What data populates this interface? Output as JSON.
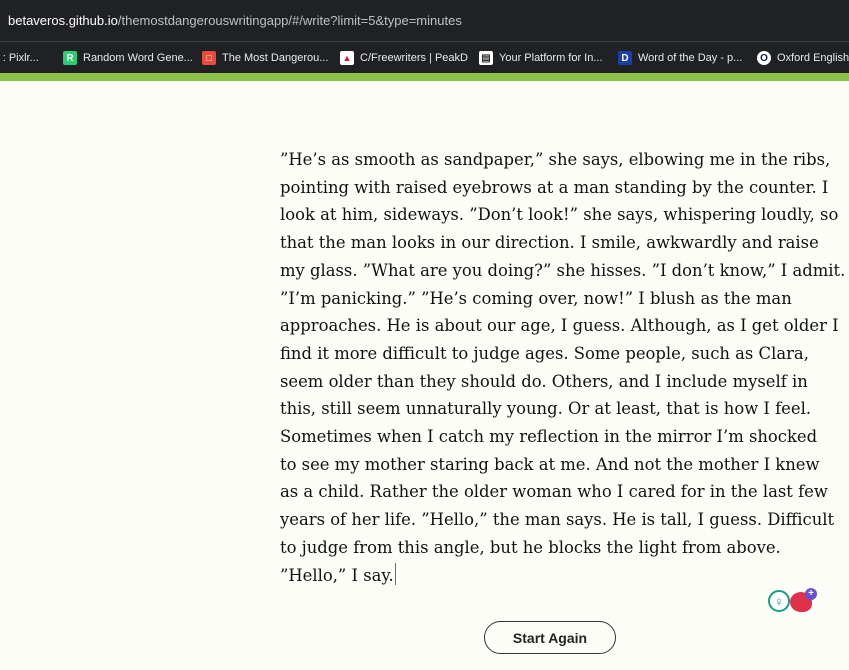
{
  "browser": {
    "url_host": "betaveros.github.io",
    "url_path": "/themostdangerouswritingapp/#/write?limit=5&type=minutes"
  },
  "bookmarks": [
    {
      "label": "r : Pixlr...",
      "icon": "pixlr-icon",
      "color": ""
    },
    {
      "label": "Random Word Gene...",
      "icon": "random-word-icon",
      "color": "#2ecc71",
      "glyph": "R"
    },
    {
      "label": "The Most Dangerou...",
      "icon": "dangerous-app-icon",
      "color": "#e74c3c",
      "glyph": "□"
    },
    {
      "label": "C/Freewriters | PeakD",
      "icon": "peakd-icon",
      "color": "#ffffff",
      "glyph": "▲"
    },
    {
      "label": "Your Platform for In...",
      "icon": "platform-icon",
      "color": "#ffffff",
      "glyph": "▤"
    },
    {
      "label": "Word of the Day - p...",
      "icon": "word-of-day-icon",
      "color": "#1a3fa8",
      "glyph": "D"
    },
    {
      "label": "Oxford English",
      "icon": "oxford-icon",
      "color": "#ffffff",
      "glyph": "O"
    }
  ],
  "editor": {
    "lines": [
      "”He’s as smooth as sandpaper,” she says, elbowing me in the ribs,",
      "pointing with raised eyebrows at a man standing by the counter. I",
      "look at him, sideways. ”Don’t look!” she says, whispering loudly, so",
      "that the man looks in our direction. I smile, awkwardly and raise",
      "my glass. ”What are you doing?” she hisses. ”I don’t know,” I admit.",
      "”I’m panicking.” ”He’s coming over, now!” I blush as the man",
      "approaches. He is about our age, I guess. Although, as I get older I",
      "find it more difficult to judge ages. Some people, such as Clara,",
      "seem older than they should do. Others, and I include myself in",
      "this, still seem unnaturally young. Or at least, that is how I feel.",
      "Sometimes when I catch my reflection in the mirror I’m shocked",
      "to see my mother staring back at me. And not the mother I knew",
      "as a child. Rather the older woman who I cared for in the last few",
      "years of her life. ”Hello,” the man says. He is tall, I guess. Difficult",
      "to judge from this angle, but he blocks the light from above.",
      "”Hello,” I say."
    ]
  },
  "start_button": {
    "label": "Start Again"
  },
  "colors": {
    "accent": "#8bc34a",
    "cursor": "#e53935"
  }
}
